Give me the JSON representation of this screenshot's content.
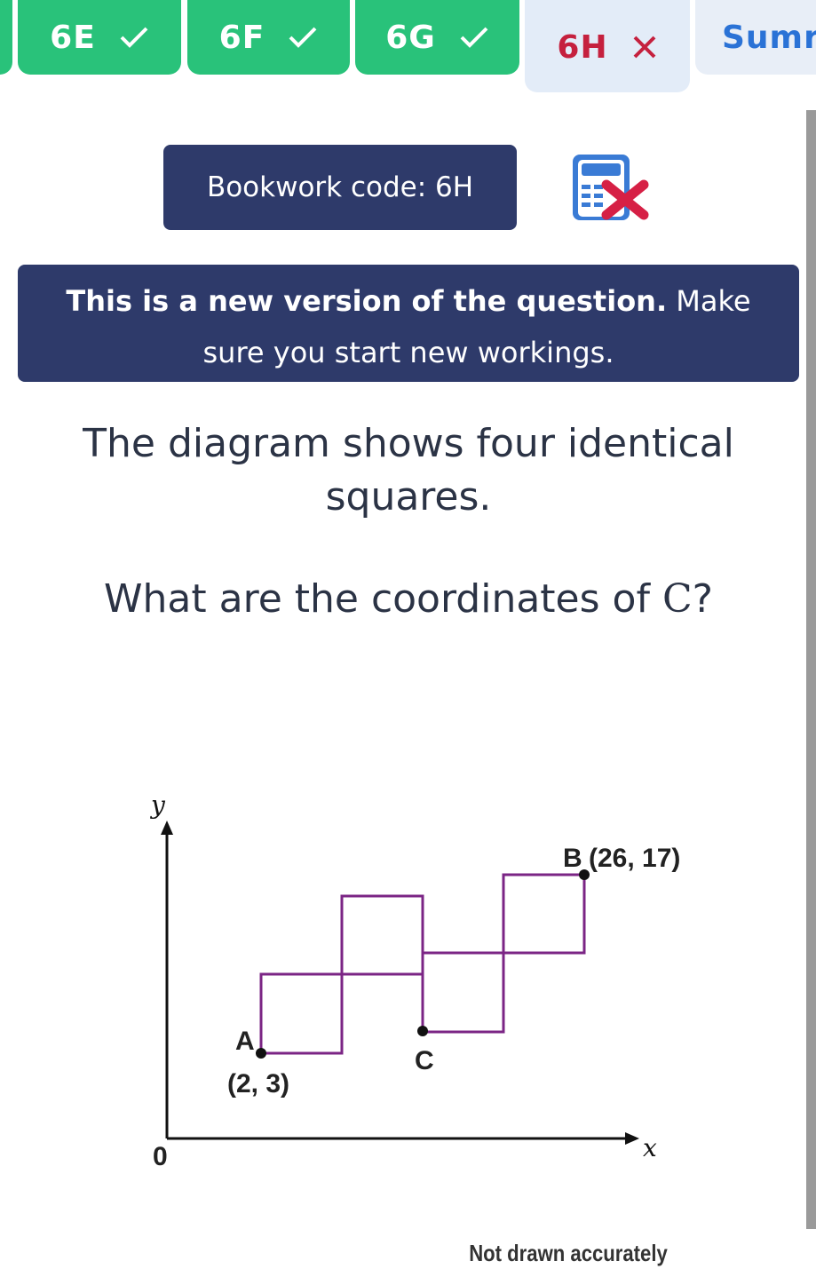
{
  "tabs": [
    {
      "label": "6E",
      "status": "correct"
    },
    {
      "label": "6F",
      "status": "correct"
    },
    {
      "label": "6G",
      "status": "correct"
    },
    {
      "label": "6H",
      "status": "incorrect"
    },
    {
      "label": "Sumr",
      "status": "summary"
    }
  ],
  "bookwork": {
    "label": "Bookwork code: 6H"
  },
  "calculator": {
    "status": "not allowed",
    "icon": "calculator-crossed-icon"
  },
  "banner": {
    "bold": "This is a new version of the question.",
    "rest": " Make sure you start new workings."
  },
  "question": {
    "line1": "The diagram shows four identical squares.",
    "line2_prefix": "What are the coordinates of ",
    "line2_var": "C",
    "line2_suffix": "?"
  },
  "diagram": {
    "y_axis": "y",
    "x_axis": "x",
    "origin": "0",
    "point_a": {
      "label": "A",
      "coords": "(2, 3)"
    },
    "point_b": {
      "label": "B",
      "coords": "(26, 17)"
    },
    "point_c": {
      "label": "C"
    },
    "note": "Not drawn accurately"
  },
  "colors": {
    "done": "#29c27a",
    "active_text": "#c5203e",
    "navy": "#2e3a6a",
    "squares": "#7b2585",
    "summary_text": "#2a72d6"
  }
}
